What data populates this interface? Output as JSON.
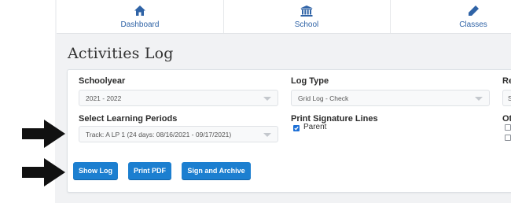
{
  "nav": {
    "items": [
      {
        "label": "Dashboard",
        "icon": "home-icon"
      },
      {
        "label": "School",
        "icon": "institution-icon"
      },
      {
        "label": "Classes",
        "icon": "pencil-icon"
      }
    ]
  },
  "page": {
    "title": "Activities Log"
  },
  "form": {
    "schoolyear": {
      "label": "Schoolyear",
      "value": "2021 - 2022"
    },
    "log_type": {
      "label": "Log Type",
      "value": "Grid Log - Check"
    },
    "report_partial": {
      "label": "Re",
      "value": "S"
    },
    "learning_periods": {
      "label": "Select Learning Periods",
      "value": "Track: A LP 1 (24 days: 08/16/2021 - 09/17/2021)"
    },
    "signature_lines": {
      "label": "Print Signature Lines",
      "options": [
        {
          "label": "Parent",
          "checked": true
        }
      ]
    },
    "other_partial": {
      "label": "Ot"
    }
  },
  "buttons": {
    "show_log": "Show Log",
    "print_pdf": "Print PDF",
    "sign_archive": "Sign and Archive"
  },
  "colors": {
    "accent": "#1c7fd0",
    "nav_text": "#2f63a6",
    "arrow": "#111111"
  }
}
